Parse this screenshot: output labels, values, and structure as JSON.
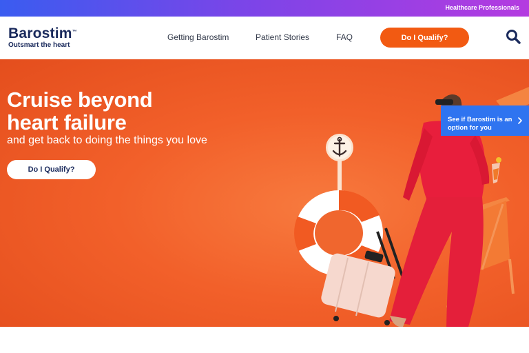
{
  "topbar": {
    "link": "Healthcare Professionals"
  },
  "header": {
    "logo": {
      "brand": "Barostim",
      "tm": "™",
      "tagline": "Outsmart the heart"
    },
    "nav": [
      "Getting Barostim",
      "Patient Stories",
      "FAQ"
    ],
    "cta": "Do I Qualify?",
    "search_icon": "search-icon"
  },
  "hero": {
    "headline_line1": "Cruise beyond",
    "headline_line2": "heart failure",
    "subhead": "and get back to doing the things you love",
    "cta": "Do I Qualify?"
  },
  "side_tab": {
    "label": "See if Barostim is an option for you",
    "icon": "chevron-right-icon"
  },
  "colors": {
    "accent": "#f25a12",
    "hero_background": "#f2602a",
    "navy": "#1a2a5c",
    "side_tab": "#2f74f0",
    "topbar_start": "#3a5cf0",
    "topbar_end": "#b43be0"
  }
}
